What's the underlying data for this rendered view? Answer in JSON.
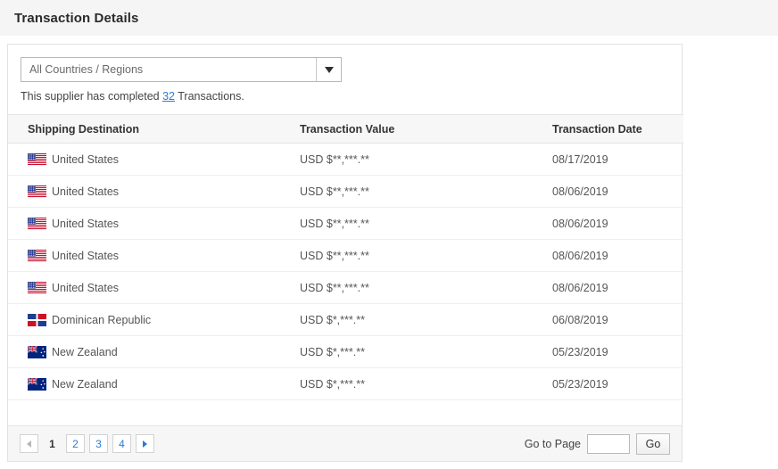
{
  "page": {
    "title": "Transaction Details"
  },
  "filter": {
    "selected": "All Countries / Regions",
    "caret_icon": "chevron-down-icon"
  },
  "summary": {
    "prefix": "This supplier has completed ",
    "count": "32",
    "suffix": " Transactions."
  },
  "table": {
    "columns": [
      "Shipping Destination",
      "Transaction Value",
      "Transaction Date"
    ],
    "rows": [
      {
        "flag": "us-flag-icon",
        "destination": "United States",
        "value": "USD $**,***.**",
        "date": "08/17/2019"
      },
      {
        "flag": "us-flag-icon",
        "destination": "United States",
        "value": "USD $**,***.**",
        "date": "08/06/2019"
      },
      {
        "flag": "us-flag-icon",
        "destination": "United States",
        "value": "USD $**,***.**",
        "date": "08/06/2019"
      },
      {
        "flag": "us-flag-icon",
        "destination": "United States",
        "value": "USD $**,***.**",
        "date": "08/06/2019"
      },
      {
        "flag": "us-flag-icon",
        "destination": "United States",
        "value": "USD $**,***.**",
        "date": "08/06/2019"
      },
      {
        "flag": "do-flag-icon",
        "destination": "Dominican Republic",
        "value": "USD $*,***.**",
        "date": "06/08/2019"
      },
      {
        "flag": "nz-flag-icon",
        "destination": "New Zealand",
        "value": "USD $*,***.**",
        "date": "05/23/2019"
      },
      {
        "flag": "nz-flag-icon",
        "destination": "New Zealand",
        "value": "USD $*,***.**",
        "date": "05/23/2019"
      }
    ]
  },
  "pagination": {
    "prev_icon": "caret-left-icon",
    "next_icon": "caret-right-icon",
    "pages": [
      "1",
      "2",
      "3",
      "4"
    ],
    "current_page": "1",
    "goto_label": "Go to Page",
    "goto_value": "",
    "go_label": "Go"
  },
  "colors": {
    "link": "#2a7bd4",
    "title_bar": "#f5f5f5",
    "header_row": "#f7f7f7",
    "footer": "#f6f6f6"
  }
}
